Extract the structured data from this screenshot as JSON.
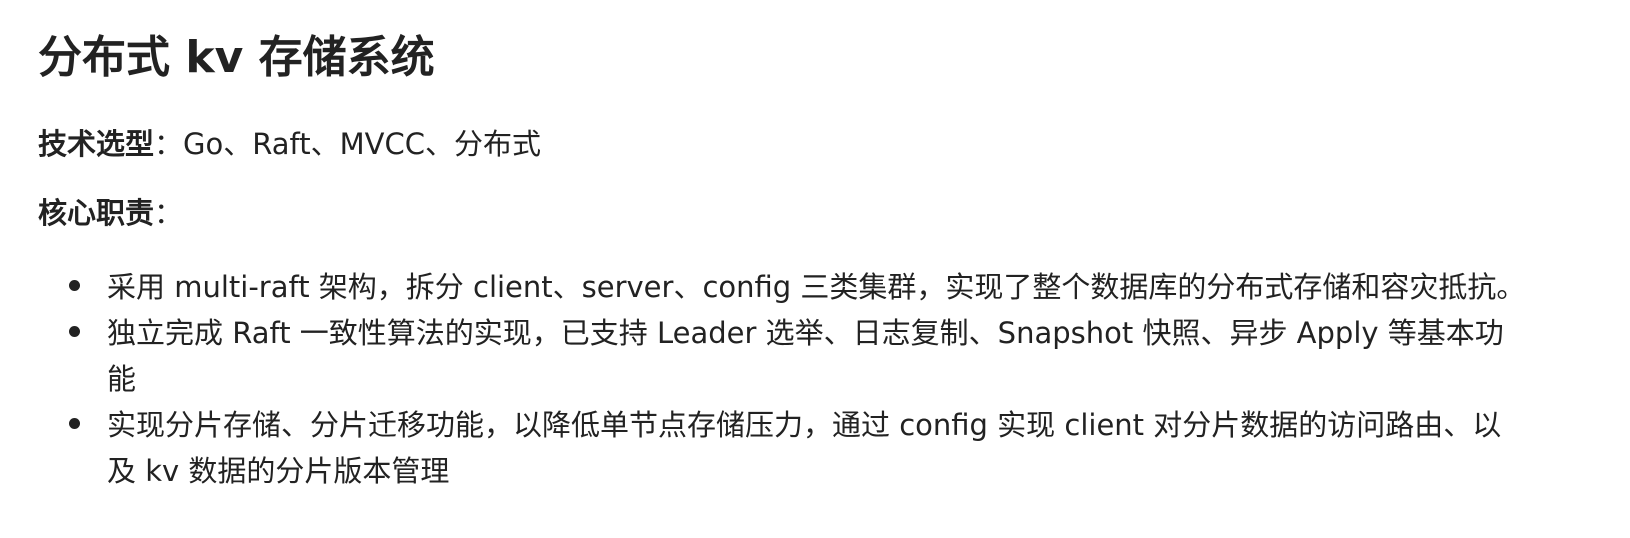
{
  "project": {
    "title": "分布式 kv 存储系统",
    "tech_label": "技术选型",
    "tech_colon": "：",
    "tech_value": "Go、Raft、MVCC、分布式",
    "duty_label": "核心职责",
    "duty_colon": "："
  },
  "duties": [
    {
      "text": "采用 multi-raft 架构，拆分 client、server、config 三类集群，实现了整个数据库的分布式存储和容灾抵抗。"
    },
    {
      "text": "独立完成 Raft 一致性算法的实现，已支持 Leader 选举、日志复制、Snapshot 快照、异步 Apply 等基本功能"
    },
    {
      "text": "实现分片存储、分片迁移功能，以降低单节点存储压力，通过 config 实现 client 对分片数据的访问路由、以及 kv 数据的分片版本管理"
    }
  ]
}
